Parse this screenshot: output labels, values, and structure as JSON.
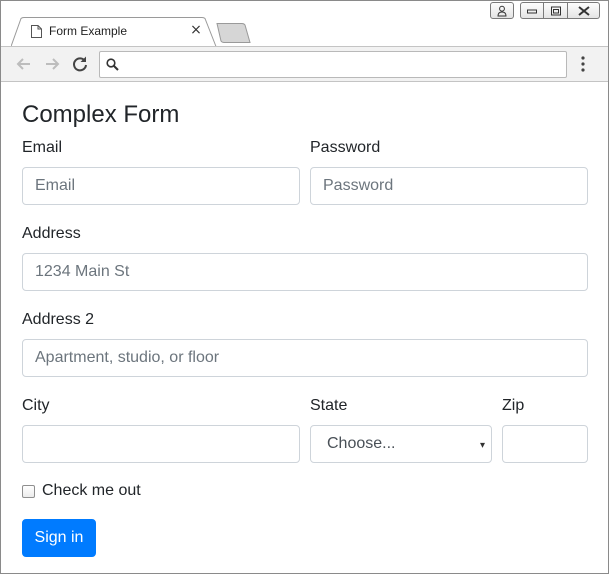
{
  "browser": {
    "tab_title": "Form Example",
    "address_value": "",
    "icons": {
      "page": "page-icon",
      "close": "close-icon",
      "back": "back-arrow-icon",
      "forward": "forward-arrow-icon",
      "reload": "reload-icon",
      "search": "search-icon",
      "menu": "vertical-ellipsis-icon",
      "user": "user-icon",
      "minimize": "minimize-icon",
      "restore": "restore-icon",
      "close_window": "close-window-icon"
    }
  },
  "form": {
    "title": "Complex Form",
    "email": {
      "label": "Email",
      "placeholder": "Email"
    },
    "password": {
      "label": "Password",
      "placeholder": "Password"
    },
    "address": {
      "label": "Address",
      "placeholder": "1234 Main St"
    },
    "address2": {
      "label": "Address 2",
      "placeholder": "Apartment, studio, or floor"
    },
    "city": {
      "label": "City",
      "value": ""
    },
    "state": {
      "label": "State",
      "selected": "Choose...",
      "caret": "▾"
    },
    "zip": {
      "label": "Zip",
      "value": ""
    },
    "checkbox": {
      "label": "Check me out",
      "checked": false
    },
    "submit": {
      "label": "Sign in"
    }
  },
  "colors": {
    "primary": "#007bff",
    "border": "#ced4da",
    "text": "#212529",
    "placeholder": "#6c757d"
  }
}
